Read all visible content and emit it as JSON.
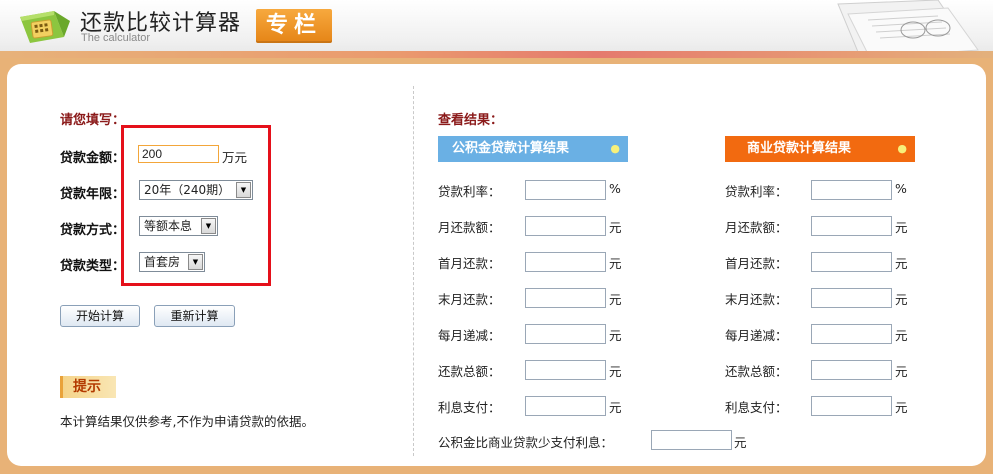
{
  "header": {
    "title": "还款比较计算器",
    "subtitle": "The calculator",
    "badge": "专栏"
  },
  "form": {
    "heading": "请您填写：",
    "amount": {
      "label": "贷款金额：",
      "value": "200",
      "unit": "万元"
    },
    "years": {
      "label": "贷款年限：",
      "selected": "20年（240期）"
    },
    "method": {
      "label": "贷款方式：",
      "selected": "等额本息"
    },
    "type": {
      "label": "贷款类型：",
      "selected": "首套房"
    },
    "calculate_label": "开始计算",
    "reset_label": "重新计算"
  },
  "tip": {
    "label": "提示",
    "text": "本计算结果仅供参考,不作为申请贷款的依据。"
  },
  "results": {
    "heading": "查看结果：",
    "fund": {
      "title": "公积金贷款计算结果",
      "color": "#6ab0e4",
      "rows": [
        {
          "label": "贷款利率：",
          "value": "",
          "unit": "%"
        },
        {
          "label": "月还款额：",
          "value": "",
          "unit": "元"
        },
        {
          "label": "首月还款：",
          "value": "",
          "unit": "元"
        },
        {
          "label": "末月还款：",
          "value": "",
          "unit": "元"
        },
        {
          "label": "每月递减：",
          "value": "",
          "unit": "元"
        },
        {
          "label": "还款总额：",
          "value": "",
          "unit": "元"
        },
        {
          "label": "利息支付：",
          "value": "",
          "unit": "元"
        }
      ]
    },
    "commercial": {
      "title": "商业贷款计算结果",
      "color": "#f26a10",
      "rows": [
        {
          "label": "贷款利率：",
          "value": "",
          "unit": "%"
        },
        {
          "label": "月还款额：",
          "value": "",
          "unit": "元"
        },
        {
          "label": "首月还款：",
          "value": "",
          "unit": "元"
        },
        {
          "label": "末月还款：",
          "value": "",
          "unit": "元"
        },
        {
          "label": "每月递减：",
          "value": "",
          "unit": "元"
        },
        {
          "label": "还款总额：",
          "value": "",
          "unit": "元"
        },
        {
          "label": "利息支付：",
          "value": "",
          "unit": "元"
        }
      ]
    },
    "savings": {
      "label": "公积金比商业贷款少支付利息：",
      "value": "",
      "unit": "元"
    }
  },
  "icons": {
    "app": "calculator-folder-icon",
    "go": "go-arrow-icon",
    "dropdown": "chevron-down-icon",
    "decoration": "newspaper-glasses-icon"
  }
}
